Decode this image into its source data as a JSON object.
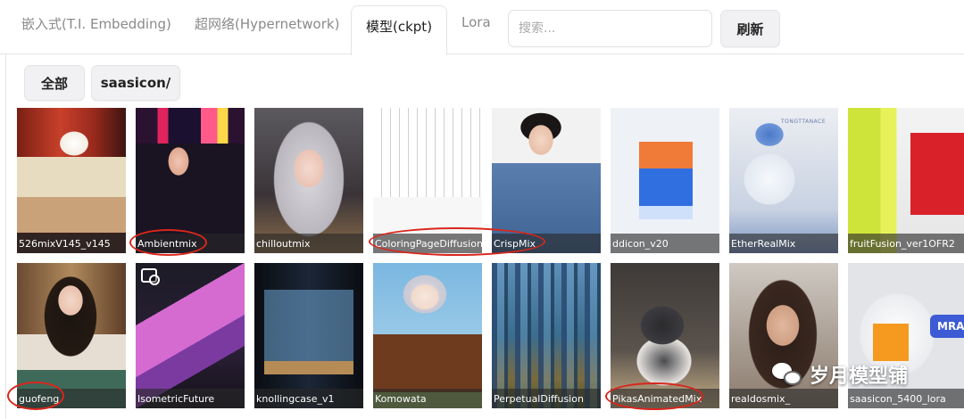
{
  "tabs": [
    {
      "label": "嵌入式(T.I. Embedding)"
    },
    {
      "label": "超网络(Hypernetwork)"
    },
    {
      "label": "模型(ckpt)"
    },
    {
      "label": "Lora"
    }
  ],
  "search": {
    "placeholder": "搜索..."
  },
  "refresh_label": "刷新",
  "filters": [
    {
      "label": "全部"
    },
    {
      "label": "saasicon/"
    }
  ],
  "cards": [
    {
      "name": "526mixV145_v145"
    },
    {
      "name": "Ambientmix"
    },
    {
      "name": "chilloutmix"
    },
    {
      "name": "ColoringPageDiffusion"
    },
    {
      "name": "CrispMix"
    },
    {
      "name": "ddicon_v20"
    },
    {
      "name": "EtherRealMix"
    },
    {
      "name": "fruitFusion_ver1OFR2"
    },
    {
      "name": "guofeng"
    },
    {
      "name": "IsometricFuture"
    },
    {
      "name": "knollingcase_v1"
    },
    {
      "name": "Komowata"
    },
    {
      "name": "PerpetualDiffusion"
    },
    {
      "name": "PikasAnimatedMix"
    },
    {
      "name": "realdosmix_"
    },
    {
      "name": "saasicon_5400_lora"
    }
  ],
  "thumb_overlay_texts": {
    "ether_top": "TONGTTANACE",
    "mra_badge": "MRA"
  },
  "watermark": {
    "text": "岁月模型铺",
    "icon": "wechat-icon"
  },
  "colors": {
    "highlight_ring": "#d9261c",
    "label_bg": "#282828"
  }
}
